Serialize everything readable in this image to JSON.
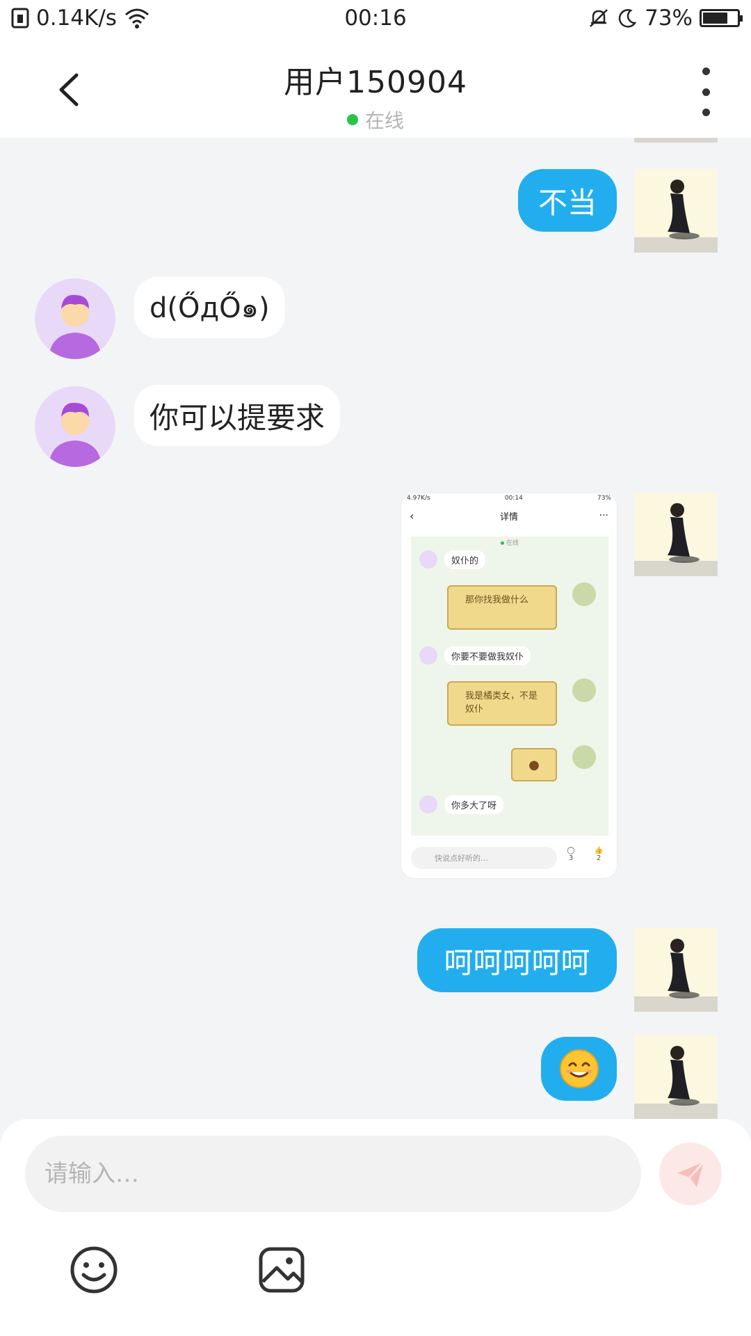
{
  "status_bar": {
    "net_speed": "0.14K/s",
    "time": "00:16",
    "battery": "73%",
    "battery_level": 0.73
  },
  "header": {
    "title": "用户150904",
    "status": "在线"
  },
  "messages": [
    {
      "side": "me",
      "text": "不当"
    },
    {
      "side": "other",
      "text": "d(ŐдŐ๑)"
    },
    {
      "side": "other",
      "text": "你可以提要求"
    },
    {
      "side": "me",
      "type": "image"
    },
    {
      "side": "me",
      "text": "呵呵呵呵呵"
    },
    {
      "side": "me",
      "text": "😊"
    }
  ],
  "screenshot_msg": {
    "status_left": "4.97K/s",
    "status_time": "00:14",
    "status_right": "73%",
    "title": "详情",
    "online": "在线",
    "lines": [
      "奴仆的",
      "那你找我做什么",
      "你要不要做我奴仆",
      "我是橘类女，不是奴仆",
      "你多大了呀"
    ],
    "comment_placeholder": "快说点好听的…",
    "comment_count": "3",
    "like_count": "2"
  },
  "input": {
    "placeholder": "请输入…"
  },
  "icons": {
    "back": "chevron-left-icon",
    "more": "more-vertical-icon",
    "send": "send-icon",
    "emoji": "emoji-icon",
    "image": "image-icon"
  },
  "colors": {
    "my_bubble": "#22aeee",
    "online_dot": "#2ac24a",
    "send_bg": "#fde8e8"
  }
}
